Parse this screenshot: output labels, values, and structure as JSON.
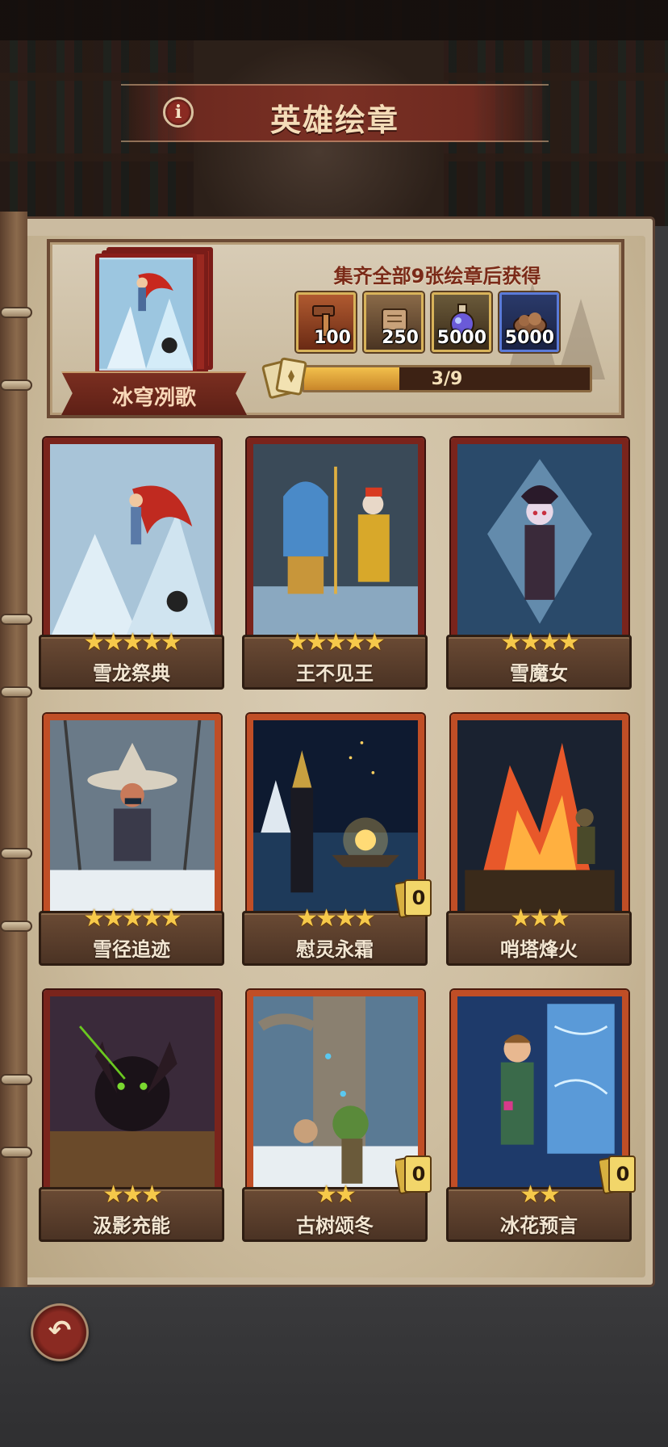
{
  "header": {
    "title": "英雄绘章",
    "info_icon": "info-icon"
  },
  "reward_panel": {
    "album_name": "冰穹冽歌",
    "title": "集齐全部9张绘章后获得",
    "rewards": [
      {
        "icon": "hammer-icon",
        "amount": "100"
      },
      {
        "icon": "scroll-icon",
        "amount": "250"
      },
      {
        "icon": "potion-icon",
        "amount": "5000"
      },
      {
        "icon": "ore-icon",
        "amount": "5000"
      }
    ],
    "progress": {
      "collected": 3,
      "total": 9,
      "label": "3/9",
      "fraction": 0.333
    }
  },
  "cards": [
    {
      "name": "雪龙祭典",
      "stars": "★★★★★",
      "star_count": 5,
      "frame": "red",
      "badge": null
    },
    {
      "name": "王不见王",
      "stars": "★★★★★",
      "star_count": 5,
      "frame": "red",
      "badge": null
    },
    {
      "name": "雪魔女",
      "stars": "★★★★",
      "star_count": 4,
      "frame": "red",
      "badge": null
    },
    {
      "name": "雪径追迹",
      "stars": "★★★★★",
      "star_count": 5,
      "frame": "orange",
      "badge": null
    },
    {
      "name": "慰灵永霜",
      "stars": "★★★★",
      "star_count": 4,
      "frame": "orange",
      "badge": "0"
    },
    {
      "name": "哨塔烽火",
      "stars": "★★★",
      "star_count": 3,
      "frame": "orange",
      "badge": null
    },
    {
      "name": "汲影充能",
      "stars": "★★★",
      "star_count": 3,
      "frame": "red",
      "badge": null
    },
    {
      "name": "古树颂冬",
      "stars": "★★",
      "star_count": 2,
      "frame": "orange",
      "badge": "0"
    },
    {
      "name": "冰花预言",
      "stars": "★★",
      "star_count": 2,
      "frame": "orange",
      "badge": "0"
    }
  ],
  "footer": {
    "back_icon": "back-arrow-icon"
  },
  "colors": {
    "accent_gold": "#f6c94a",
    "frame_red": "#7a241c",
    "frame_orange": "#c04e26",
    "banner": "#7a3024"
  }
}
